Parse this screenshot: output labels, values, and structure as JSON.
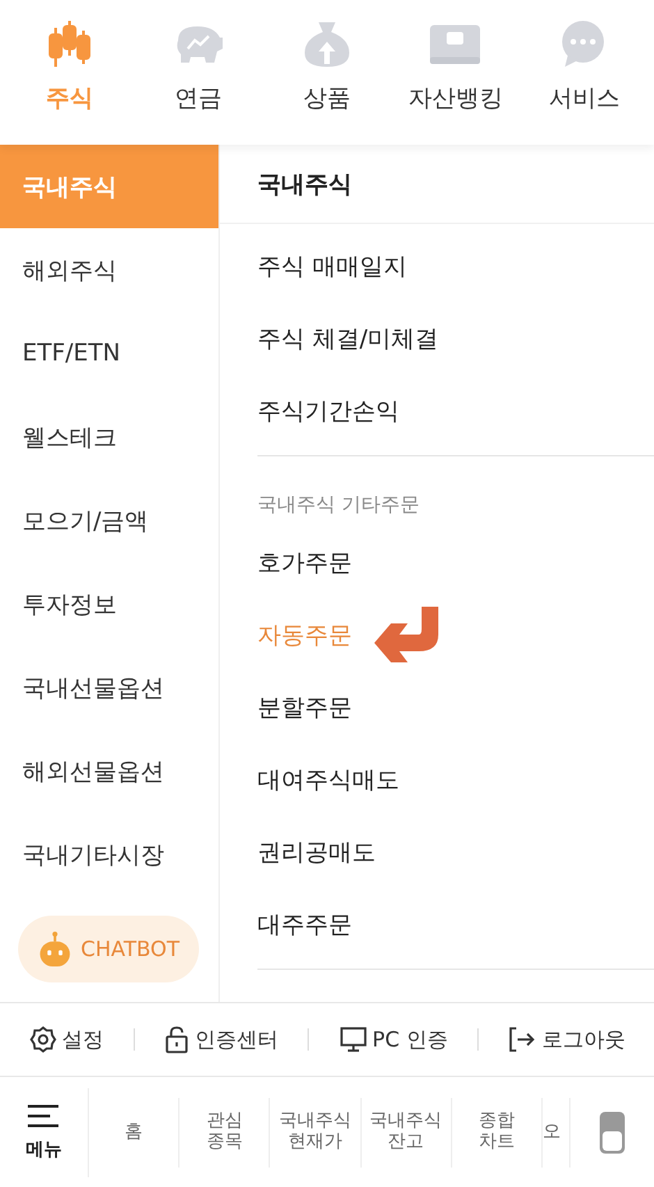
{
  "top_tabs": [
    {
      "label": "주식",
      "kind": "candles",
      "selected": true
    },
    {
      "label": "연금",
      "kind": "piggy",
      "selected": false
    },
    {
      "label": "상품",
      "kind": "bag",
      "selected": false
    },
    {
      "label": "자산뱅킹",
      "kind": "wallet",
      "selected": false
    },
    {
      "label": "서비스",
      "kind": "chat",
      "selected": false
    }
  ],
  "sidebar": {
    "items": [
      {
        "label": "국내주식",
        "selected": true
      },
      {
        "label": "해외주식",
        "selected": false
      },
      {
        "label": "ETF/ETN",
        "selected": false
      },
      {
        "label": "웰스테크",
        "selected": false
      },
      {
        "label": "모으기/금액",
        "selected": false
      },
      {
        "label": "투자정보",
        "selected": false
      },
      {
        "label": "국내선물옵션",
        "selected": false
      },
      {
        "label": "해외선물옵션",
        "selected": false
      },
      {
        "label": "국내기타시장",
        "selected": false
      }
    ],
    "chatbot": "CHATBOT"
  },
  "panel": {
    "title": "국내주식",
    "sections": [
      {
        "items": [
          {
            "label": "주식 매매일지",
            "highlighted": false
          },
          {
            "label": "주식 체결/미체결",
            "highlighted": false
          },
          {
            "label": "주식기간손익",
            "highlighted": false
          }
        ]
      },
      {
        "label": "국내주식 기타주문",
        "items": [
          {
            "label": "호가주문",
            "highlighted": false
          },
          {
            "label": "자동주문",
            "highlighted": true
          },
          {
            "label": "분할주문",
            "highlighted": false
          },
          {
            "label": "대여주식매도",
            "highlighted": false
          },
          {
            "label": "권리공매도",
            "highlighted": false
          },
          {
            "label": "대주주문",
            "highlighted": false
          }
        ]
      }
    ]
  },
  "footer_links": [
    {
      "label": "설정",
      "kind": "gear"
    },
    {
      "label": "인증센터",
      "kind": "lock"
    },
    {
      "label": "PC 인증",
      "kind": "monitor"
    },
    {
      "label": "로그아웃",
      "kind": "logout"
    }
  ],
  "bottom_nav": {
    "menu": "메뉴",
    "items": [
      "홈",
      "관심\n종목",
      "국내주식\n현재가",
      "국내주식\n잔고",
      "종합\n차트",
      "오"
    ]
  }
}
